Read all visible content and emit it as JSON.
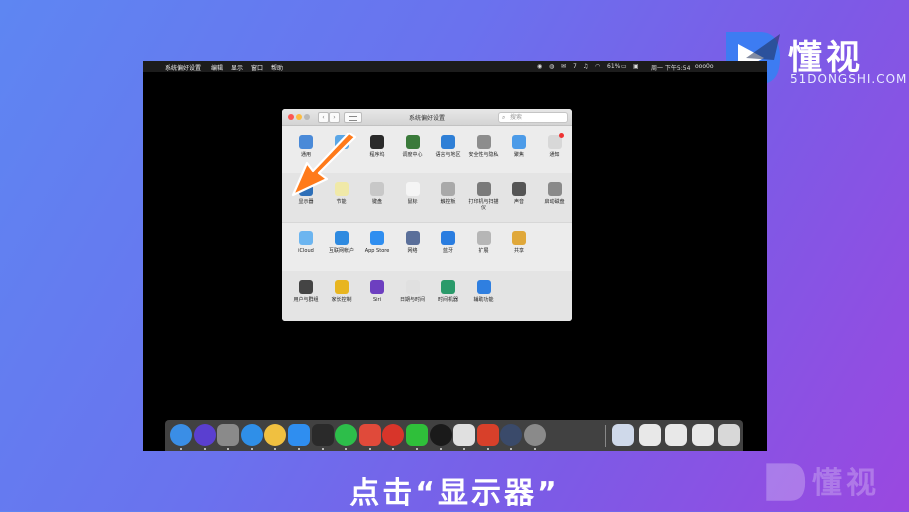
{
  "brand": {
    "name": "懂视",
    "site": "51DONGSHI.COM"
  },
  "menubar": {
    "app": "系统偏好设置",
    "items": [
      "编辑",
      "显示",
      "窗口",
      "帮助"
    ],
    "status": {
      "battery": "61%",
      "clock": "周一 下午5:54",
      "user": "ooo0o",
      "badge": "7"
    }
  },
  "prefs": {
    "title": "系统偏好设置",
    "search_placeholder": "搜索",
    "rows": [
      [
        {
          "label": "通用",
          "icon": "general-icon",
          "color": "#4a8ad8"
        },
        {
          "label": "",
          "icon": "desktop-icon",
          "color": "#5aa6e6"
        },
        {
          "label": "程序坞",
          "icon": "dock-icon",
          "color": "#2a2a2a"
        },
        {
          "label": "调度中心",
          "icon": "mission-control-icon",
          "color": "#3a7a3a"
        },
        {
          "label": "语言与地区",
          "icon": "language-icon",
          "color": "#2f7fd6"
        },
        {
          "label": "安全性与隐私",
          "icon": "security-icon",
          "color": "#8d8d8d"
        },
        {
          "label": "聚焦",
          "icon": "spotlight-icon",
          "color": "#4c9be8"
        },
        {
          "label": "通知",
          "icon": "notifications-icon",
          "color": "#d8d8d8"
        }
      ],
      [
        {
          "label": "显示器",
          "icon": "display-icon",
          "color": "#2d6fb8"
        },
        {
          "label": "节能",
          "icon": "energy-icon",
          "color": "#f0e9a8"
        },
        {
          "label": "键盘",
          "icon": "keyboard-icon",
          "color": "#c8c8c8"
        },
        {
          "label": "鼠标",
          "icon": "mouse-icon",
          "color": "#f5f5f5"
        },
        {
          "label": "触控板",
          "icon": "trackpad-icon",
          "color": "#a9a9a9"
        },
        {
          "label": "打印机与扫描仪",
          "icon": "printer-icon",
          "color": "#7a7a7a"
        },
        {
          "label": "声音",
          "icon": "sound-icon",
          "color": "#555"
        },
        {
          "label": "启动磁盘",
          "icon": "startup-disk-icon",
          "color": "#8a8a8a"
        }
      ],
      [
        {
          "label": "iCloud",
          "icon": "icloud-icon",
          "color": "#6cb5f0"
        },
        {
          "label": "互联网帐户",
          "icon": "internet-accounts-icon",
          "color": "#2e8ae0"
        },
        {
          "label": "App Store",
          "icon": "app-store-icon",
          "color": "#2f8ef0"
        },
        {
          "label": "网络",
          "icon": "network-icon",
          "color": "#5a6f9a"
        },
        {
          "label": "蓝牙",
          "icon": "bluetooth-icon",
          "color": "#2a7de0"
        },
        {
          "label": "扩展",
          "icon": "extensions-icon",
          "color": "#b6b6b6"
        },
        {
          "label": "共享",
          "icon": "sharing-icon",
          "color": "#e0a83a"
        }
      ],
      [
        {
          "label": "用户与群组",
          "icon": "users-icon",
          "color": "#444"
        },
        {
          "label": "家长控制",
          "icon": "parental-controls-icon",
          "color": "#e8b520"
        },
        {
          "label": "Siri",
          "icon": "siri-icon",
          "color": "#6d3fc0"
        },
        {
          "label": "日期与时间",
          "icon": "date-time-icon",
          "color": "#e0e0e0"
        },
        {
          "label": "时间机器",
          "icon": "time-machine-icon",
          "color": "#2a9a6a"
        },
        {
          "label": "辅助功能",
          "icon": "accessibility-icon",
          "color": "#2f7fe0"
        }
      ]
    ]
  },
  "dock": [
    {
      "name": "finder-icon",
      "color": "#3a8ee6"
    },
    {
      "name": "siri-dock-icon",
      "color": "#5a3fd0"
    },
    {
      "name": "launchpad-icon",
      "color": "#8a8a8a"
    },
    {
      "name": "safari-icon",
      "color": "#2f8fe8"
    },
    {
      "name": "photos-icon",
      "color": "#f0c040"
    },
    {
      "name": "app-store-dock-icon",
      "color": "#2f8ef0"
    },
    {
      "name": "pen-app-icon",
      "color": "#2a2a2a"
    },
    {
      "name": "wechat-icon",
      "color": "#2dbe4a"
    },
    {
      "name": "media-app-icon",
      "color": "#e04a3a"
    },
    {
      "name": "netease-music-icon",
      "color": "#d8352a"
    },
    {
      "name": "iqiyi-icon",
      "color": "#2fbf3a"
    },
    {
      "name": "qq-icon",
      "color": "#1a1a1a"
    },
    {
      "name": "wps-icon",
      "color": "#e0e0e0"
    },
    {
      "name": "wps-presentation-icon",
      "color": "#d8402a"
    },
    {
      "name": "browser-icon",
      "color": "#3a4a6a"
    },
    {
      "name": "system-preferences-dock-icon",
      "color": "#8a8a8a"
    },
    {
      "name": "document-icon",
      "color": "#cfd9ea"
    },
    {
      "name": "screenshot-thumb-1-icon",
      "color": "#e8e8e8"
    },
    {
      "name": "screenshot-thumb-2-icon",
      "color": "#e8e8e8"
    },
    {
      "name": "screenshot-thumb-3-icon",
      "color": "#e8e8e8"
    },
    {
      "name": "trash-icon",
      "color": "#d8d8d8"
    }
  ],
  "caption": "点击“显示器”",
  "accent": "#ff7a1a"
}
